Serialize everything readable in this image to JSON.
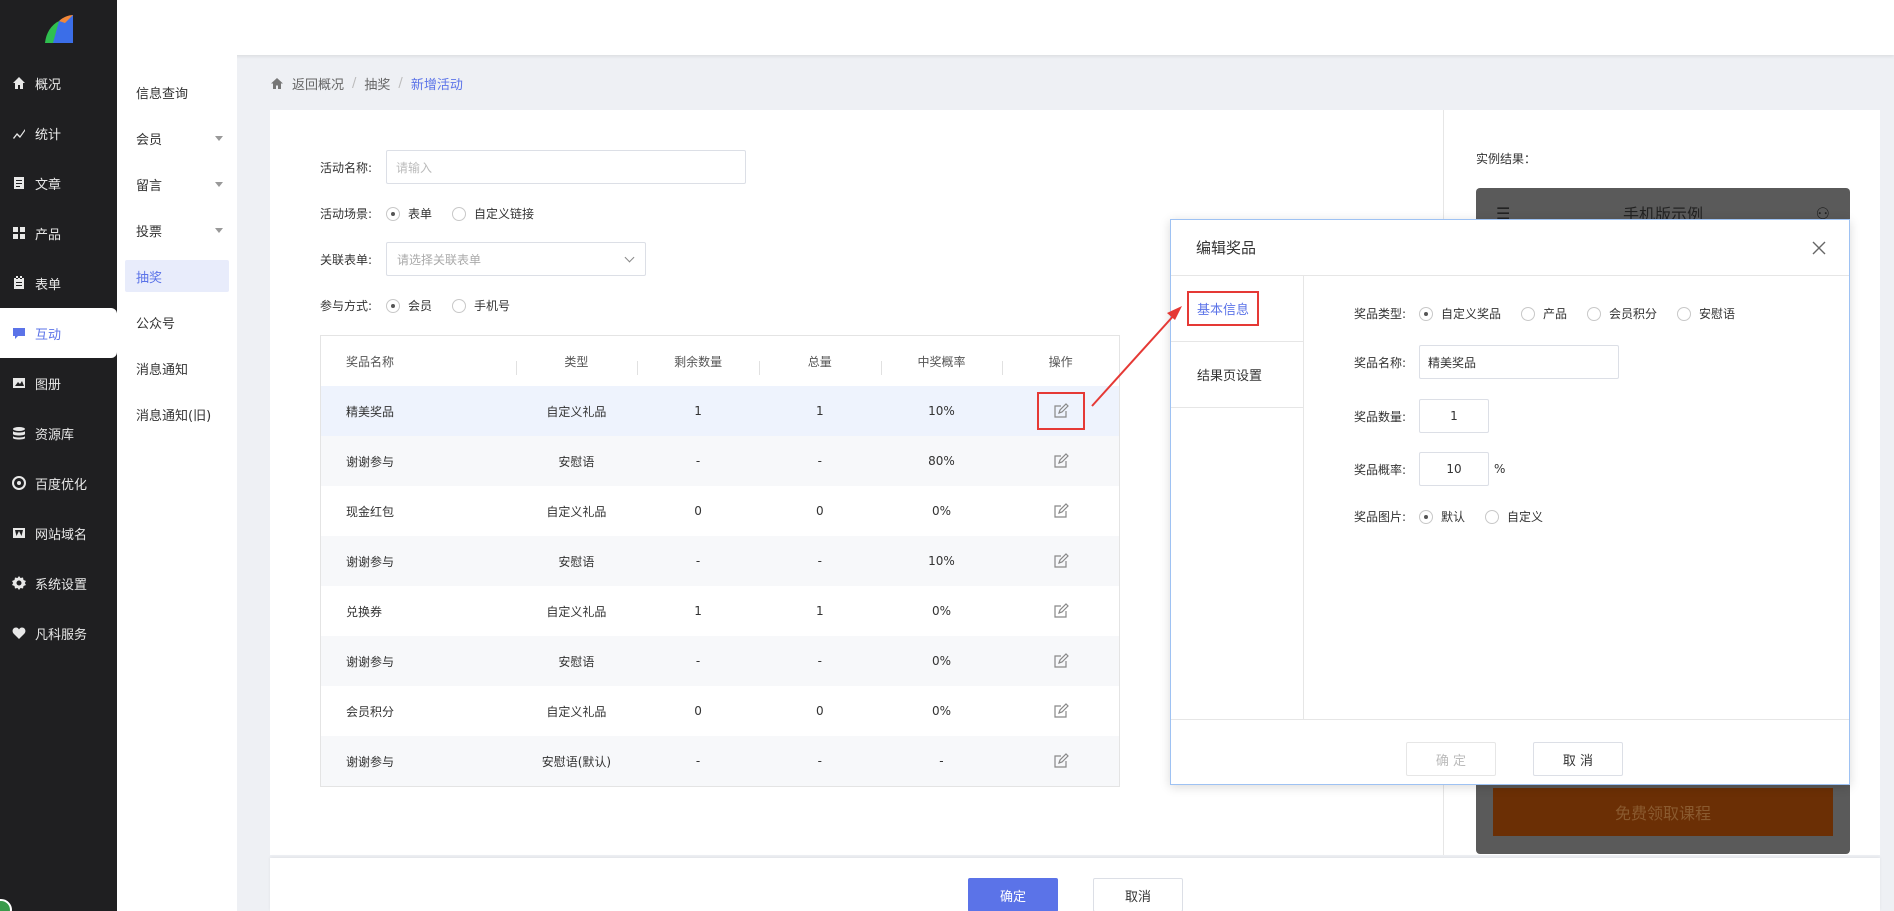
{
  "sidebar": {
    "items": [
      {
        "label": "概况",
        "icon": "home-icon"
      },
      {
        "label": "统计",
        "icon": "stats-icon"
      },
      {
        "label": "文章",
        "icon": "article-icon"
      },
      {
        "label": "产品",
        "icon": "product-icon"
      },
      {
        "label": "表单",
        "icon": "form-icon"
      },
      {
        "label": "互动",
        "icon": "interaction-icon",
        "active": true
      },
      {
        "label": "图册",
        "icon": "gallery-icon"
      },
      {
        "label": "资源库",
        "icon": "database-icon"
      },
      {
        "label": "百度优化",
        "icon": "seo-icon"
      },
      {
        "label": "网站域名",
        "icon": "domain-icon"
      },
      {
        "label": "系统设置",
        "icon": "gear-icon"
      },
      {
        "label": "凡科服务",
        "icon": "heart-icon"
      }
    ]
  },
  "submenu": {
    "items": [
      {
        "label": "信息查询"
      },
      {
        "label": "会员",
        "has_caret": true
      },
      {
        "label": "留言",
        "has_caret": true
      },
      {
        "label": "投票",
        "has_caret": true
      },
      {
        "label": "抽奖",
        "active": true
      },
      {
        "label": "公众号"
      },
      {
        "label": "消息通知"
      },
      {
        "label": "消息通知(旧)"
      }
    ]
  },
  "breadcrumb": {
    "back": "返回概况",
    "parent": "抽奖",
    "current": "新增活动"
  },
  "form": {
    "name_label": "活动名称:",
    "name_placeholder": "请输入",
    "scene_label": "活动场景:",
    "scene_opt1": "表单",
    "scene_opt2": "自定义链接",
    "linked_label": "关联表单:",
    "linked_placeholder": "请选择关联表单",
    "join_label": "参与方式:",
    "join_opt1": "会员",
    "join_opt2": "手机号"
  },
  "table": {
    "headers": [
      "奖品名称",
      "类型",
      "剩余数量",
      "总量",
      "中奖概率",
      "操作"
    ],
    "rows": [
      [
        "精美奖品",
        "自定义礼品",
        "1",
        "1",
        "10%"
      ],
      [
        "谢谢参与",
        "安慰语",
        "-",
        "-",
        "80%"
      ],
      [
        "现金红包",
        "自定义礼品",
        "0",
        "0",
        "0%"
      ],
      [
        "谢谢参与",
        "安慰语",
        "-",
        "-",
        "10%"
      ],
      [
        "兑换券",
        "自定义礼品",
        "1",
        "1",
        "0%"
      ],
      [
        "谢谢参与",
        "安慰语",
        "-",
        "-",
        "0%"
      ],
      [
        "会员积分",
        "自定义礼品",
        "0",
        "0",
        "0%"
      ],
      [
        "谢谢参与",
        "安慰语(默认)",
        "-",
        "-",
        "-"
      ]
    ]
  },
  "preview": {
    "label": "实例结果：",
    "phone_title": "手机版示例",
    "cta": "免费领取课程"
  },
  "footer": {
    "confirm": "确定",
    "cancel": "取消"
  },
  "modal": {
    "title": "编辑奖品",
    "nav_basic": "基本信息",
    "nav_result": "结果页设置",
    "type_label": "奖品类型:",
    "type_opts": [
      "自定义奖品",
      "产品",
      "会员积分",
      "安慰语"
    ],
    "name_label": "奖品名称:",
    "name_value": "精美奖品",
    "count_label": "奖品数量:",
    "count_value": "1",
    "rate_label": "奖品概率:",
    "rate_value": "10",
    "rate_unit": "%",
    "image_label": "奖品图片:",
    "image_opt1": "默认",
    "image_opt2": "自定义",
    "confirm": "确 定",
    "cancel": "取 消"
  },
  "colors": {
    "accent": "#5b73e8",
    "highlight": "#e53935",
    "sidebar_bg": "#1f1f21"
  }
}
